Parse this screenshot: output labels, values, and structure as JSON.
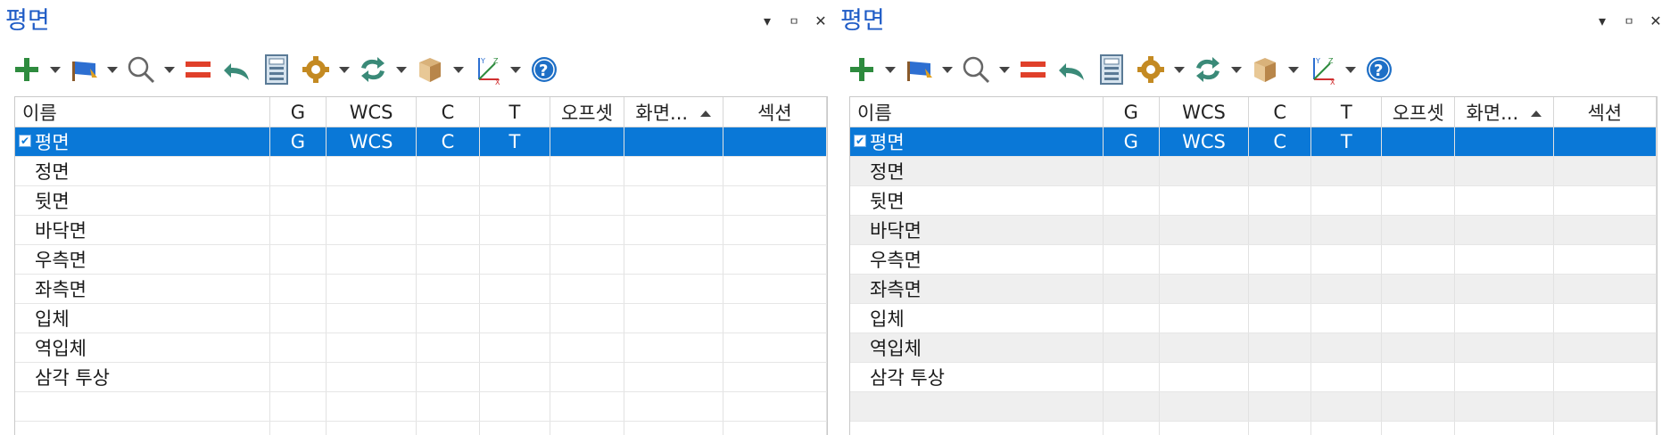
{
  "panels": [
    {
      "title": "평면",
      "window_controls": {
        "dropdown": "▾",
        "pin": "ㅁ",
        "close": "✕"
      },
      "toolbar": {
        "buttons": [
          {
            "icon": "add-icon",
            "has_dropdown": true
          },
          {
            "icon": "flag-icon",
            "has_dropdown": true
          },
          {
            "icon": "search-icon",
            "has_dropdown": true
          },
          {
            "icon": "equals-icon",
            "has_dropdown": false
          },
          {
            "icon": "undo-icon",
            "has_dropdown": false
          },
          {
            "icon": "calculator-icon",
            "has_dropdown": false
          },
          {
            "icon": "gear-icon",
            "has_dropdown": true
          },
          {
            "icon": "refresh-icon",
            "has_dropdown": true
          },
          {
            "icon": "box-icon",
            "has_dropdown": true
          },
          {
            "icon": "axes-icon",
            "has_dropdown": true
          },
          {
            "icon": "help-icon",
            "has_dropdown": false
          }
        ]
      },
      "columns": [
        "이름",
        "G",
        "WCS",
        "C",
        "T",
        "오프셋",
        "화면...",
        "섹션"
      ],
      "rows": [
        {
          "name": "평면",
          "g": "G",
          "wcs": "WCS",
          "c": "C",
          "t": "T",
          "selected": true,
          "checked": true
        },
        {
          "name": "정면",
          "g": "",
          "wcs": "",
          "c": "",
          "t": ""
        },
        {
          "name": "뒷면",
          "g": "",
          "wcs": "",
          "c": "",
          "t": ""
        },
        {
          "name": "바닥면",
          "g": "",
          "wcs": "",
          "c": "",
          "t": ""
        },
        {
          "name": "우측면",
          "g": "",
          "wcs": "",
          "c": "",
          "t": ""
        },
        {
          "name": "좌측면",
          "g": "",
          "wcs": "",
          "c": "",
          "t": ""
        },
        {
          "name": "입체",
          "g": "",
          "wcs": "",
          "c": "",
          "t": ""
        },
        {
          "name": "역입체",
          "g": "",
          "wcs": "",
          "c": "",
          "t": ""
        },
        {
          "name": "삼각 투상",
          "g": "",
          "wcs": "",
          "c": "",
          "t": ""
        },
        {
          "name": "",
          "g": "",
          "wcs": "",
          "c": "",
          "t": ""
        },
        {
          "name": "",
          "g": "",
          "wcs": "",
          "c": "",
          "t": ""
        }
      ]
    },
    {
      "title": "평면",
      "window_controls": {
        "dropdown": "▾",
        "pin": "ㅁ",
        "close": "✕"
      },
      "columns": [
        "이름",
        "G",
        "WCS",
        "C",
        "T",
        "오프셋",
        "화면...",
        "섹션"
      ],
      "rows": [
        {
          "name": "평면",
          "g": "G",
          "wcs": "WCS",
          "c": "C",
          "t": "T",
          "selected": true,
          "checked": true
        },
        {
          "name": "정면",
          "g": "",
          "wcs": "",
          "c": "",
          "t": ""
        },
        {
          "name": "뒷면",
          "g": "",
          "wcs": "",
          "c": "",
          "t": ""
        },
        {
          "name": "바닥면",
          "g": "",
          "wcs": "",
          "c": "",
          "t": ""
        },
        {
          "name": "우측면",
          "g": "",
          "wcs": "",
          "c": "",
          "t": ""
        },
        {
          "name": "좌측면",
          "g": "",
          "wcs": "",
          "c": "",
          "t": ""
        },
        {
          "name": "입체",
          "g": "",
          "wcs": "",
          "c": "",
          "t": ""
        },
        {
          "name": "역입체",
          "g": "",
          "wcs": "",
          "c": "",
          "t": ""
        },
        {
          "name": "삼각 투상",
          "g": "",
          "wcs": "",
          "c": "",
          "t": ""
        },
        {
          "name": "",
          "g": "",
          "wcs": "",
          "c": "",
          "t": ""
        },
        {
          "name": "",
          "g": "",
          "wcs": "",
          "c": "",
          "t": ""
        }
      ]
    }
  ],
  "colors": {
    "accent": "#1e5bc6",
    "selection": "#0a78d7",
    "alt_row": "#efefef"
  }
}
